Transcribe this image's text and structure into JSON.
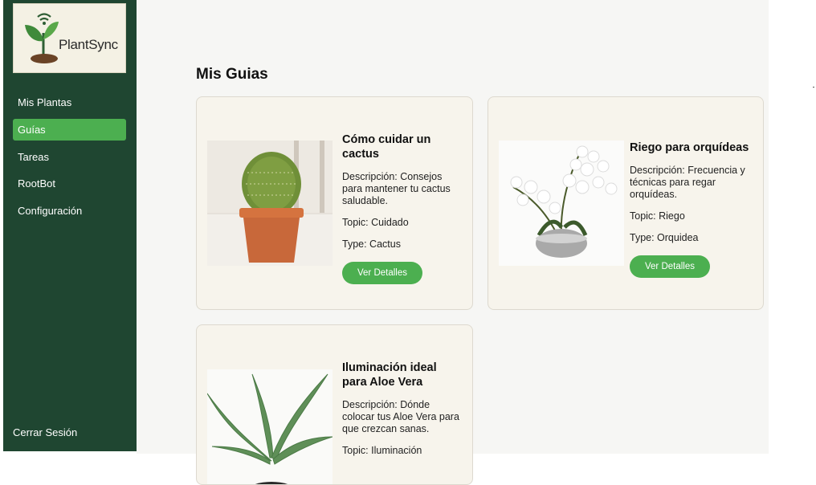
{
  "app": {
    "name": "PlantSync"
  },
  "sidebar": {
    "items": [
      {
        "label": "Mis Plantas"
      },
      {
        "label": "Guías"
      },
      {
        "label": "Tareas"
      },
      {
        "label": "RootBot"
      },
      {
        "label": "Configuración"
      }
    ],
    "active_item": "Guías",
    "logout_label": "Cerrar Sesión"
  },
  "main": {
    "title": "Mis Guias",
    "cards": [
      {
        "title": "Cómo cuidar un cactus",
        "description": "Descripción: Consejos para mantener tu cactus saludable.",
        "topic": "Topic: Cuidado",
        "type": "Type: Cactus",
        "button": "Ver Detalles",
        "image": "cactus-pot"
      },
      {
        "title": "Riego para orquídeas",
        "description": "Descripción: Frecuencia y técnicas para regar orquídeas.",
        "topic": "Topic: Riego",
        "type": "Type: Orquidea",
        "button": "Ver Detalles",
        "image": "white-orchid"
      },
      {
        "title": "Iluminación ideal para Aloe Vera",
        "description": "Descripción: Dónde colocar tus Aloe Vera para que crezcan sanas.",
        "topic": "Topic: Iluminación",
        "image": "aloe-vera"
      }
    ]
  },
  "colors": {
    "sidebar_bg": "#1f4631",
    "accent": "#4caf50",
    "card_bg": "#f7f4ec"
  }
}
